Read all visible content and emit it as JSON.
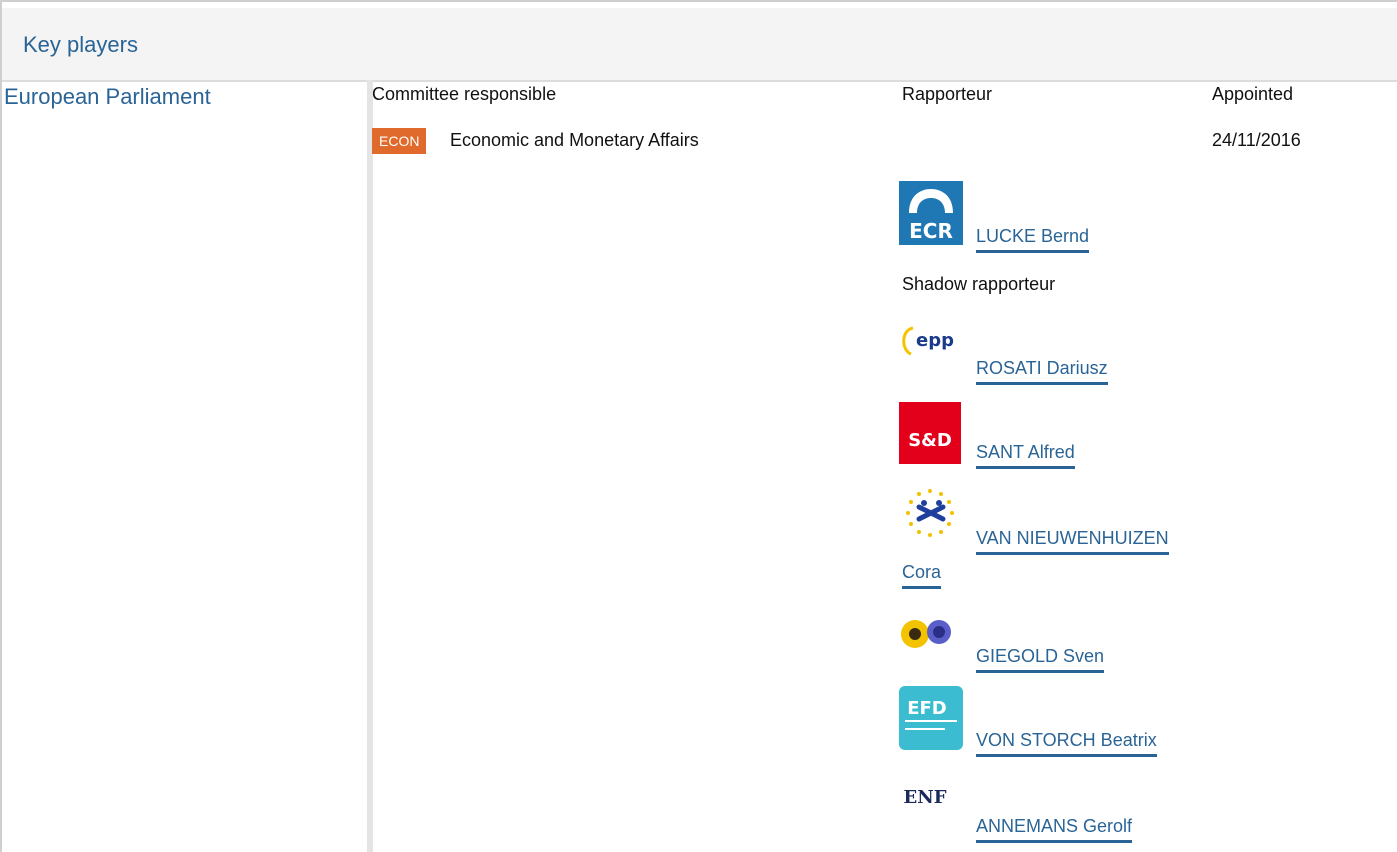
{
  "section": {
    "title": "Key players"
  },
  "institution": {
    "name": "European Parliament"
  },
  "columns": {
    "committee": "Committee responsible",
    "rapporteur": "Rapporteur",
    "appointed": "Appointed"
  },
  "committee": {
    "code": "ECON",
    "name": "Economic and Monetary Affairs",
    "appointed": "24/11/2016",
    "badge_color": "#e06a2b"
  },
  "rapporteur": {
    "name": "LUCKE Bernd",
    "group_logo": "ECR",
    "logo_text": "ECR"
  },
  "shadow_label": "Shadow rapporteur",
  "shadows": [
    {
      "name": "ROSATI Dariusz",
      "group_logo": "EPP",
      "logo_text": "epp"
    },
    {
      "name": "SANT Alfred",
      "group_logo": "S&D",
      "logo_text": "S&D"
    },
    {
      "name_line1": "VAN NIEUWENHUIZEN",
      "name_line2": "Cora",
      "group_logo": "ALDE"
    },
    {
      "name": "GIEGOLD Sven",
      "group_logo": "Greens/EFA"
    },
    {
      "name": "VON STORCH Beatrix",
      "group_logo": "EFDD",
      "logo_text": "EFD"
    },
    {
      "name": "ANNEMANS Gerolf",
      "group_logo": "ENF",
      "logo_text": "ENF"
    }
  ],
  "colors": {
    "link": "#2a6496",
    "ecr": "#1f78b4",
    "sd": "#e2001a",
    "efdd": "#3bbcd0"
  }
}
